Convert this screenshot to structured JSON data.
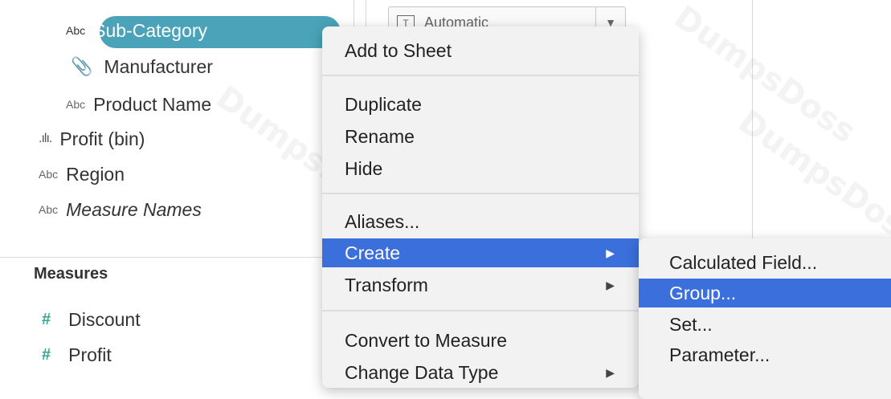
{
  "sidebar": {
    "dimensions": [
      {
        "label": "Sub-Category",
        "icon": "abc",
        "selected": true
      },
      {
        "label": "Manufacturer",
        "icon": "paperclip"
      },
      {
        "label": "Product Name",
        "icon": "abc"
      },
      {
        "label": "Profit (bin)",
        "icon": "bin"
      },
      {
        "label": "Region",
        "icon": "abc"
      },
      {
        "label": "Measure Names",
        "icon": "abc",
        "italic": true
      }
    ],
    "measures_title": "Measures",
    "measures": [
      {
        "label": "Discount",
        "icon": "hash"
      },
      {
        "label": "Profit",
        "icon": "hash"
      }
    ]
  },
  "icons": {
    "abc": "Abc",
    "hash": "#",
    "bin": ".ılı.",
    "paperclip": "📎",
    "submenu_arrow": "▶",
    "dropdown_arrow": "▼"
  },
  "marks_shelf": {
    "value": "Automatic"
  },
  "context_menu": {
    "items": [
      "Add to Sheet",
      "Duplicate",
      "Rename",
      "Hide",
      "Aliases...",
      "Create",
      "Transform",
      "Convert to Measure",
      "Change Data Type"
    ],
    "selected": "Create"
  },
  "create_submenu": {
    "items": [
      "Calculated Field...",
      "Group...",
      "Set...",
      "Parameter..."
    ],
    "selected": "Group..."
  },
  "colors": {
    "pill": "#4aa3b8",
    "menu_highlight": "#3b6fdb",
    "measure_icon": "#3aa692"
  }
}
